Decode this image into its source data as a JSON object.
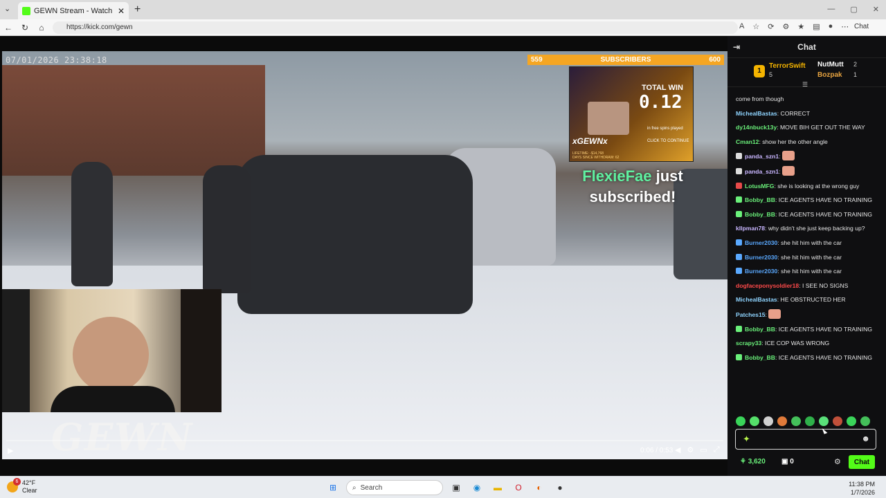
{
  "browser": {
    "tab_title": "GEWN Stream - Watch Live on Kick",
    "tab_close": "✕",
    "new_tab": "+",
    "url": "https://kick.com/gewn",
    "copilot_label": "Chat"
  },
  "stream": {
    "timestamp": "07/01/2026 23:38:18",
    "subgoal": {
      "current": "559",
      "label": "SUBSCRIBERS",
      "target": "600"
    },
    "promo": {
      "total_win_label": "TOTAL WIN",
      "total_win_value": "0.12",
      "free_spins": "in free spins played",
      "continue": "CLICK TO CONTINUE",
      "brand": "xGEWNx",
      "lifetime": "LIFETIME: -$14,768",
      "days_since": "DAYS SINCE WITHDRAW: 62"
    },
    "sub_alert": {
      "username": "FlexieFae",
      "line1": " just",
      "line2": "subscribed!"
    },
    "logo": "GEWN",
    "player": {
      "time": "0:06 / 0:53"
    }
  },
  "chat": {
    "title": "Chat",
    "leaderboard": [
      {
        "rank": "1",
        "name": "TerrorSwift",
        "count": "5"
      },
      {
        "name": "NutMutt",
        "count": "2"
      },
      {
        "name": "Bozpak",
        "count": "1"
      }
    ],
    "messages": [
      {
        "user": "",
        "text": "come from though",
        "color": "#e6e6e6"
      },
      {
        "user": "MichealBastas",
        "text": ": CORRECT",
        "color": "#8fd4ff"
      },
      {
        "user": "dy14nbuck13y",
        "text": ": MOVE BIH GET OUT THE WAY",
        "color": "#6af07a"
      },
      {
        "user": "Cman12",
        "text": ": show her the other angle",
        "color": "#6af07a"
      },
      {
        "user": "panda_szn1",
        "text": ":",
        "color": "#c9b6ff"
      },
      {
        "user": "panda_szn1",
        "text": ":",
        "color": "#c9b6ff"
      },
      {
        "user": "LotusMFG",
        "text": ": she is looking at the wrong guy",
        "color": "#6af07a"
      },
      {
        "user": "Bobby_BB",
        "text": ": ICE AGENTS HAVE NO TRAINING",
        "color": "#6af07a"
      },
      {
        "user": "Bobby_BB",
        "text": ": ICE AGENTS HAVE NO TRAINING",
        "color": "#6af07a"
      },
      {
        "user": "kllpman78",
        "text": ": why didn't she just keep backing up?",
        "color": "#c9b6ff"
      },
      {
        "user": "Burner2030",
        "text": ": she hit him with the car",
        "color": "#5aa9ff"
      },
      {
        "user": "Burner2030",
        "text": ": she hit him with the car",
        "color": "#5aa9ff"
      },
      {
        "user": "Burner2030",
        "text": ": she hit him with the car",
        "color": "#5aa9ff"
      },
      {
        "user": "dogfaceponysoldier18",
        "text": ": I SEE NO SIGNS",
        "color": "#ff4a4a"
      },
      {
        "user": "MichealBastas",
        "text": ": HE OBSTRUCTED HER",
        "color": "#8fd4ff"
      },
      {
        "user": "Patches15",
        "text": ":",
        "color": "#8fd4ff"
      },
      {
        "user": "Bobby_BB",
        "text": ": ICE AGENTS HAVE NO TRAINING",
        "color": "#6af07a"
      },
      {
        "user": "scrapy33",
        "text": ": ICE COP WAS WRONG",
        "color": "#6af07a"
      },
      {
        "user": "Bobby_BB",
        "text": ": ICE AGENTS HAVE NO TRAINING",
        "color": "#6af07a"
      }
    ],
    "points": "3,620",
    "gift_count": "0",
    "send_label": "Chat"
  },
  "taskbar": {
    "weather_badge": "6",
    "temp": "42°F",
    "condition": "Clear",
    "search_placeholder": "Search",
    "time": "11:38 PM",
    "date": "1/7/2026"
  },
  "colors": {
    "kick_green": "#53fc18",
    "subgoal_orange": "#f5a623"
  }
}
